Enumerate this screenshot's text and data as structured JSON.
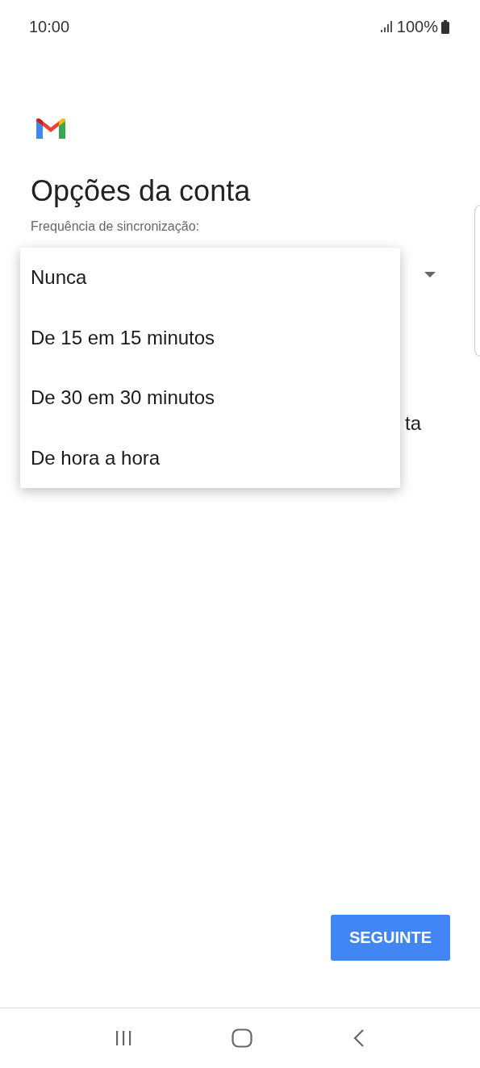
{
  "status_bar": {
    "time": "10:00",
    "battery": "100%"
  },
  "title": "Opções da conta",
  "sync_label": "Frequência de sincronização:",
  "hidden_text": "ta",
  "menu": [
    {
      "label": "Nunca",
      "selected": false
    },
    {
      "label": "De 15 em 15 minutos",
      "selected": false
    },
    {
      "label": "De 30 em 30 minutos",
      "selected": false
    },
    {
      "label": "De hora a hora",
      "selected": false
    }
  ],
  "next_button": "SEGUINTE"
}
